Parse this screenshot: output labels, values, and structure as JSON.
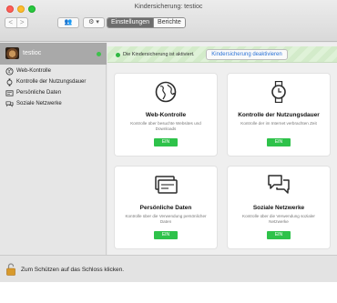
{
  "window": {
    "title": "Kindersicherung: testioc"
  },
  "toolbar": {
    "back_icon": "chevron-left-icon",
    "forward_icon": "chevron-right-icon",
    "back_glyph": "<",
    "forward_glyph": ">",
    "users_glyph": "👥",
    "gear_glyph": "⚙ ▾",
    "tabs": [
      {
        "label": "Einstellungen",
        "active": true
      },
      {
        "label": "Berichte",
        "active": false
      }
    ]
  },
  "sidebar": {
    "user": {
      "name": "testioc",
      "status_color": "#3dc24b"
    },
    "items": [
      {
        "label": "Web-Kontrolle",
        "icon": "globe-icon"
      },
      {
        "label": "Kontrolle der Nutzungsdauer",
        "icon": "watch-icon"
      },
      {
        "label": "Persönliche Daten",
        "icon": "card-icon"
      },
      {
        "label": "Soziale Netzwerke",
        "icon": "chat-icon"
      }
    ]
  },
  "banner": {
    "text": "Die Kindersicherung ist aktiviert.",
    "button": "Kindersicherung deaktivieren",
    "status_color": "#30b843"
  },
  "cards": [
    {
      "title": "Web-Kontrolle",
      "desc": "Kontrolle über besuchte Websites und Downloads",
      "button": "EIN",
      "icon": "globe-icon"
    },
    {
      "title": "Kontrolle der Nutzungsdauer",
      "desc": "Kontrolle der im Internet verbrachten Zeit",
      "button": "EIN",
      "icon": "watch-icon"
    },
    {
      "title": "Persönliche Daten",
      "desc": "Kontrolle über die Verwendung persönlicher Daten",
      "button": "EIN",
      "icon": "card-icon"
    },
    {
      "title": "Soziale Netzwerke",
      "desc": "Kontrolle über die Verwendung sozialer Netzwerke",
      "button": "EIN",
      "icon": "chat-icon"
    }
  ],
  "footer": {
    "text": "Zum Schützen auf das Schloss klicken.",
    "icon": "lock-icon"
  },
  "colors": {
    "accent_green": "#2ec24a",
    "link_blue": "#2a72d6"
  }
}
